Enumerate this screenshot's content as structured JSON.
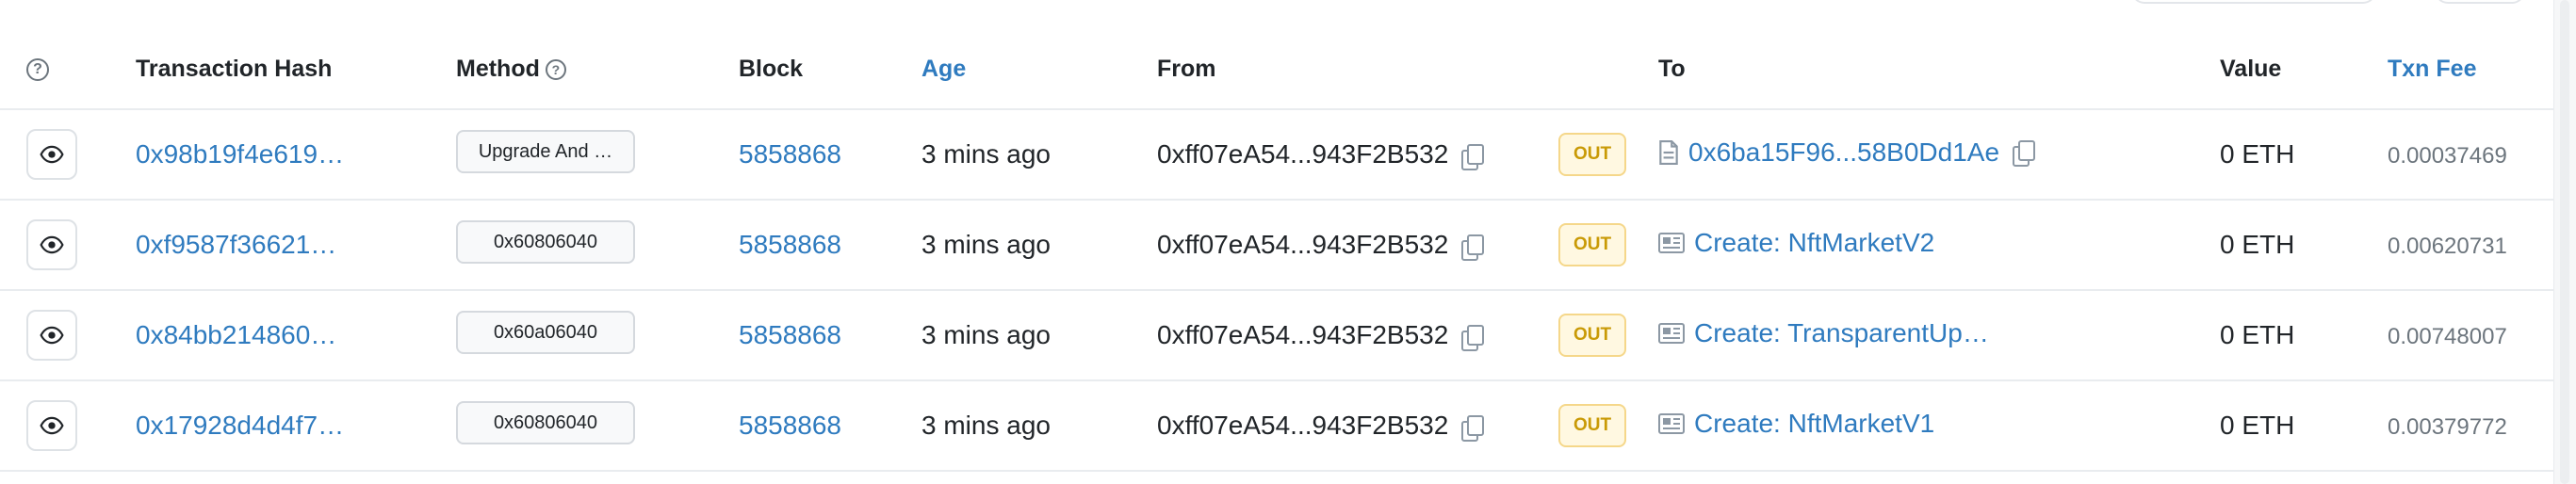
{
  "columns": {
    "help": "?",
    "hash": "Transaction Hash",
    "method": "Method",
    "block": "Block",
    "age": "Age",
    "from": "From",
    "to": "To",
    "value": "Value",
    "fee": "Txn Fee"
  },
  "icons": {
    "view": "eye-icon",
    "copy": "copy-icon",
    "help": "question-circle-icon",
    "to_wallet": "document-icon",
    "to_contract": "contract-icon"
  },
  "colors": {
    "link": "#2f7bbf",
    "out_badge_text": "#c99a06",
    "out_badge_bg": "#fff8e1",
    "out_badge_border": "#f5d78a",
    "fee_text": "#6c757d"
  },
  "rows": [
    {
      "hash": "0x98b19f4e619…",
      "method": "Upgrade And …",
      "block": "5858868",
      "age": "3 mins ago",
      "from": "0xff07eA54...943F2B532",
      "direction": "OUT",
      "to": "0x6ba15F96...58B0Dd1Ae",
      "value": "0 ETH",
      "fee": "0.00037469"
    },
    {
      "hash": "0xf9587f36621…",
      "method": "0x60806040",
      "block": "5858868",
      "age": "3 mins ago",
      "from": "0xff07eA54...943F2B532",
      "direction": "OUT",
      "to": "Create: NftMarketV2",
      "value": "0 ETH",
      "fee": "0.00620731"
    },
    {
      "hash": "0x84bb214860…",
      "method": "0x60a06040",
      "block": "5858868",
      "age": "3 mins ago",
      "from": "0xff07eA54...943F2B532",
      "direction": "OUT",
      "to": "Create: TransparentUp…",
      "value": "0 ETH",
      "fee": "0.00748007"
    },
    {
      "hash": "0x17928d4d4f7…",
      "method": "0x60806040",
      "block": "5858868",
      "age": "3 mins ago",
      "from": "0xff07eA54...943F2B532",
      "direction": "OUT",
      "to": "Create: NftMarketV1",
      "value": "0 ETH",
      "fee": "0.00379772"
    }
  ]
}
